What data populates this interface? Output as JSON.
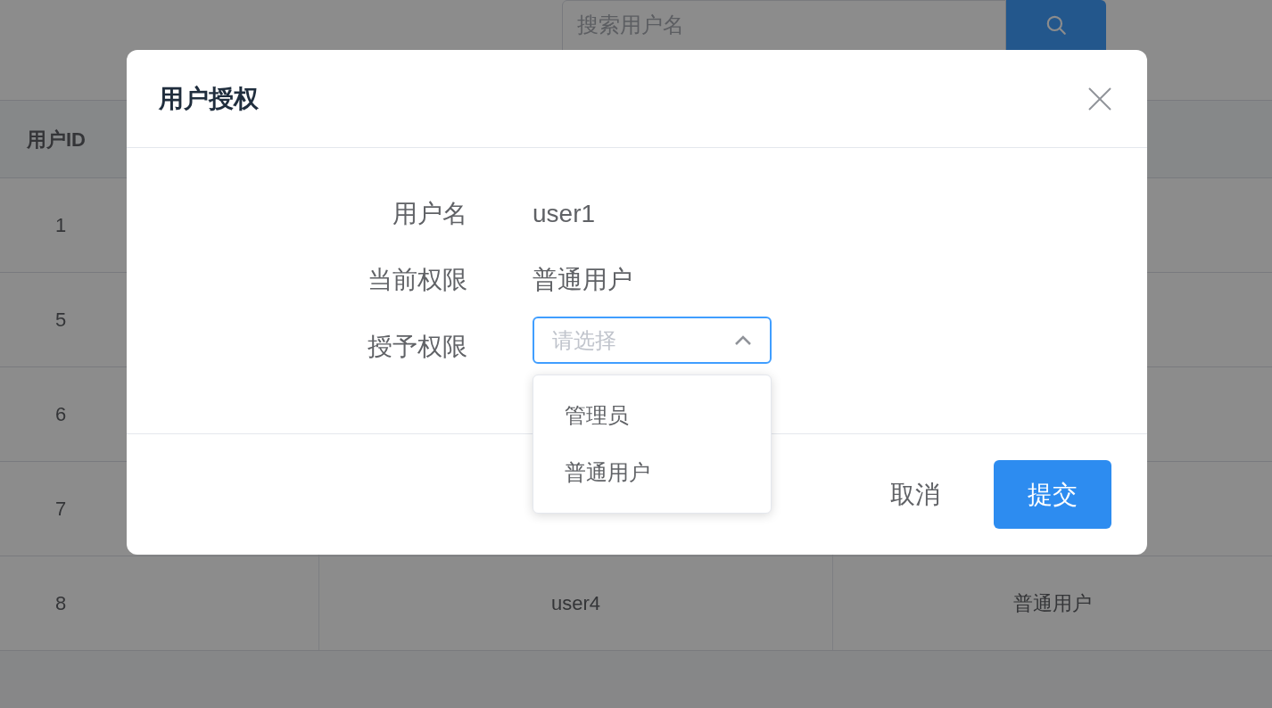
{
  "search": {
    "placeholder": "搜索用户名"
  },
  "table": {
    "columns": [
      "用户ID"
    ],
    "rows": [
      {
        "cells": [
          "1"
        ]
      },
      {
        "cells": [
          "5"
        ]
      },
      {
        "cells": [
          "6"
        ]
      },
      {
        "cells": [
          "7"
        ]
      },
      {
        "cells": [
          "8",
          "user4",
          "普通用户"
        ]
      }
    ]
  },
  "dialog": {
    "title": "用户授权",
    "fields": [
      {
        "label": "用户名",
        "value": "user1"
      },
      {
        "label": "当前权限",
        "value": "普通用户"
      }
    ],
    "select": {
      "label": "授予权限",
      "placeholder": "请选择",
      "expanded": true,
      "options": [
        {
          "label": "管理员",
          "selected": false
        },
        {
          "label": "普通用户",
          "selected": false
        }
      ]
    },
    "buttons": [
      {
        "label": "取消",
        "kind": "text"
      },
      {
        "label": "提交",
        "kind": "primary"
      }
    ]
  }
}
